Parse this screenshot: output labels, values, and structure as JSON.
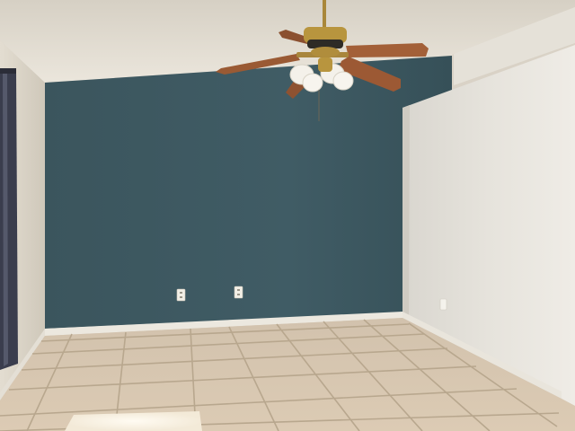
{
  "scene": {
    "subject": "empty-room",
    "colors": {
      "ceiling": "#e6e1d6",
      "accent_wall": "#3f5a63",
      "accent_wall_shadow": "#354d55",
      "left_wall": "#dcd5c8",
      "right_wall": "#e7e4dc",
      "baseboard": "#ece8df",
      "floor_tile": "#d8c7b0",
      "floor_grout": "#b9a88f",
      "curtain": "#3c3f4f",
      "fan_blade": "#9a5a34",
      "fan_brass": "#b8953e",
      "fan_glass": "#f4f1ea",
      "outlet": "#f2efe6",
      "sunlight": "#fbf7ec"
    }
  }
}
